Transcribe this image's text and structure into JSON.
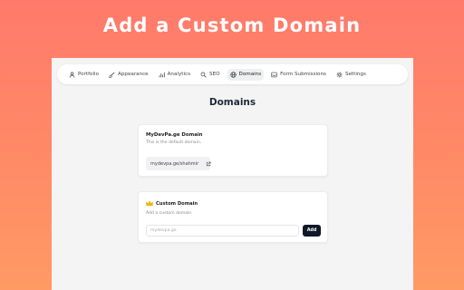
{
  "hero": {
    "title": "Add a Custom Domain"
  },
  "nav": {
    "items": [
      {
        "label": "Portfolio",
        "icon": "user-icon"
      },
      {
        "label": "Appearance",
        "icon": "brush-icon"
      },
      {
        "label": "Analytics",
        "icon": "chart-icon"
      },
      {
        "label": "SEO",
        "icon": "search-icon"
      },
      {
        "label": "Domains",
        "icon": "globe-icon",
        "active": true
      },
      {
        "label": "Form Submissions",
        "icon": "inbox-icon"
      },
      {
        "label": "Settings",
        "icon": "gear-icon"
      }
    ]
  },
  "page": {
    "heading": "Domains"
  },
  "default_domain": {
    "title": "MyDevPa.ge Domain",
    "description": "This is the default domain.",
    "url": "mydevpa.ge/shahmir"
  },
  "custom_domain": {
    "title": "Custom Domain",
    "description": "Add a custom domain.",
    "input_placeholder": "mydevpa.ge",
    "input_value": "",
    "add_label": "Add"
  },
  "colors": {
    "background_top": "#ff7a6b",
    "background_bottom": "#ff9a64",
    "app_background": "#f4f4f5",
    "primary_button": "#111827",
    "crown": "#f5b800"
  }
}
